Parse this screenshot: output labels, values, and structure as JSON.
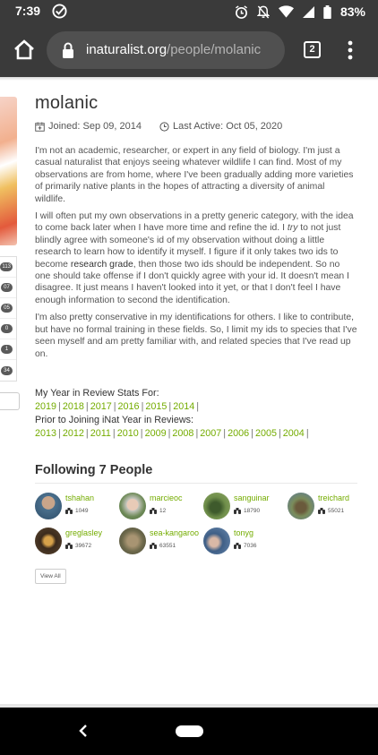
{
  "status_bar": {
    "time": "7:39",
    "battery": "83%"
  },
  "browser": {
    "url_host": "inaturalist.org",
    "url_path": "/people/molanic",
    "tab_count": "2"
  },
  "sidebar": {
    "stats": [
      "113",
      "07",
      "05",
      "0",
      "1",
      "34"
    ]
  },
  "profile": {
    "username": "molanic",
    "joined": "Joined: Sep 09, 2014",
    "last_active": "Last Active: Oct 05, 2020"
  },
  "bio": {
    "p1": "I'm not an academic, researcher, or expert in any field of biology. I'm just a casual naturalist that enjoys seeing whatever wildlife I can find. Most of my observations are from home, where I've been gradually adding more varieties of primarily native plants in the hopes of attracting a diversity of animal wildlife.",
    "p2_a": "I will often put my own observations in a pretty generic category, with the idea to come back later when I have more time and refine the id. I ",
    "p2_em": "try",
    "p2_b": " to not just blindly agree with someone's id of my observation without doing a little research to learn how to identify it myself. I figure if it only takes two ids to become ",
    "p2_strong": "research grade",
    "p2_c": ", then those two ids should be independent. So no one should take offense if I don't quickly agree with your id. It doesn't mean I disagree. It just means I haven't looked into it yet, or that I don't feel I have enough information to second the identification.",
    "p3": "I'm also pretty conservative in my identifications for others. I like to contribute, but have no formal training in these fields. So, I limit my ids to species that I've seen myself and am pretty familiar with, and related species that I've read up on."
  },
  "year_in_review": {
    "label": "My Year in Review Stats For:",
    "years": [
      "2019",
      "2018",
      "2017",
      "2016",
      "2015",
      "2014"
    ],
    "prior_label": "Prior to Joining iNat Year in Reviews:",
    "prior_years": [
      "2013",
      "2012",
      "2011",
      "2010",
      "2009",
      "2008",
      "2007",
      "2006",
      "2005",
      "2004"
    ]
  },
  "following": {
    "title": "Following 7 People",
    "people": [
      {
        "name": "tshahan",
        "count": "1049"
      },
      {
        "name": "marcieoc",
        "count": "12"
      },
      {
        "name": "sanguinar",
        "count": "18790"
      },
      {
        "name": "treichard",
        "count": "55021"
      },
      {
        "name": "greglasley",
        "count": "39672"
      },
      {
        "name": "sea-kangaroo",
        "count": "63551"
      },
      {
        "name": "tonyg",
        "count": "7036"
      }
    ],
    "view_all": "View All"
  }
}
